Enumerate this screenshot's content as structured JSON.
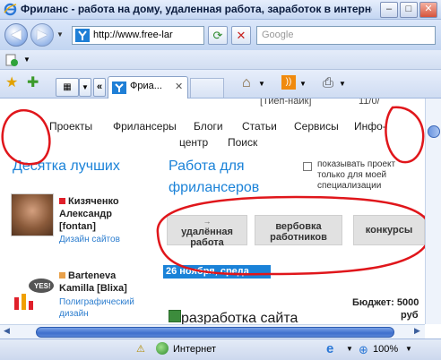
{
  "window": {
    "title": "Фриланс - работа на дому, удаленная работа, заработок в интернете,...",
    "minimize": "–",
    "maximize": "□",
    "close": "✕"
  },
  "navbar": {
    "back_icon": "back-arrow",
    "forward_icon": "forward-arrow",
    "address": "http://www.free-lar",
    "refresh_icon": "refresh-icon",
    "stop_icon": "stop-icon",
    "search_placeholder": "Google"
  },
  "tabs": {
    "active_label": "Фриа...",
    "close": "✕",
    "recent_label": "«"
  },
  "page": {
    "header_cut": "[Тиёп-наик]",
    "date_cut": "11/0/",
    "topnav": [
      "Проекты",
      "Фрилансеры",
      "Блоги",
      "Статьи",
      "Сервисы",
      "Инфо-",
      "центр",
      "Поиск"
    ],
    "top_heading": "Десятка лучших",
    "jobs_heading_line1": "Работа для",
    "jobs_heading_line2": "фрилансеров",
    "checkbox_label": "показывать проект только для моей специализации",
    "freelancers": [
      {
        "name_line1": "Кизяченко",
        "name_line2": "Александр",
        "name_line3": "[fontan]",
        "spec": "Дизайн сайтов"
      },
      {
        "name_line1": "Barteneva",
        "name_line2": "Kamilla [Blixa]",
        "spec_line1": "Полиграфический",
        "spec_line2": "дизайн"
      }
    ],
    "categories": [
      {
        "line1": "удалённая",
        "line2": "работа"
      },
      {
        "line1": "вербовка",
        "line2": "работников"
      },
      {
        "line1": "конкурсы",
        "line2": ""
      }
    ],
    "date": "26 ноября, среда",
    "budget_label": "Бюджет: 5000",
    "budget_currency": "руб",
    "job_title": "разработка сайта"
  },
  "status": {
    "zone": "Интернет",
    "zoom": "100%"
  },
  "colors": {
    "accent_blue": "#1a82d8",
    "annotation_red": "#e0161b"
  }
}
